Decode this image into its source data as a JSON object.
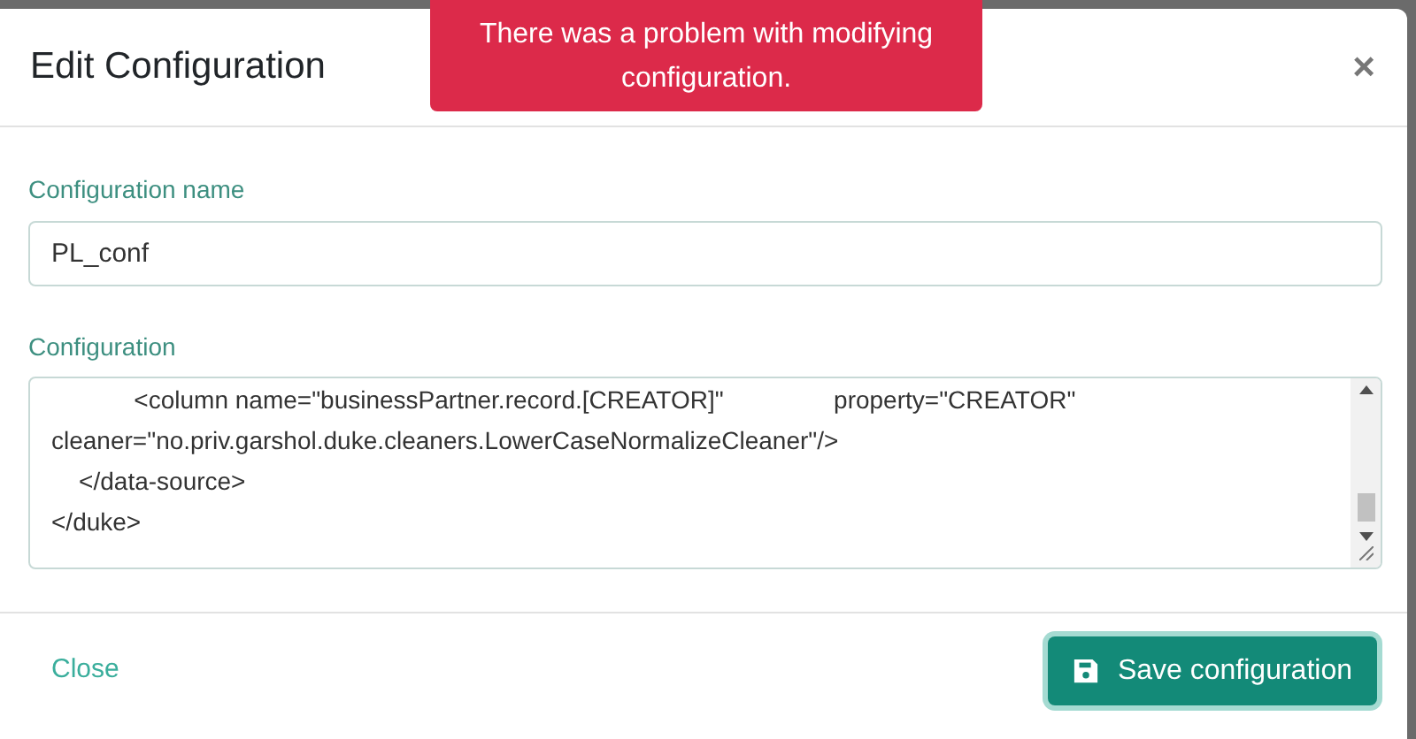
{
  "dialog": {
    "title": "Edit Configuration",
    "close_symbol": "×"
  },
  "toast": {
    "message": "There was a problem with modifying configuration."
  },
  "fields": [
    {
      "label": "Configuration name",
      "value": "PL_conf"
    },
    {
      "label": "Configuration",
      "lines": [
        "            <column name=\"businessPartner.record.[CREATOR]\"                property=\"CREATOR\"",
        "cleaner=\"no.priv.garshol.duke.cleaners.LowerCaseNormalizeCleaner\"/>",
        "    </data-source>",
        "</duke>"
      ]
    }
  ],
  "footer": {
    "close_label": "Close",
    "save_label": "Save configuration"
  }
}
